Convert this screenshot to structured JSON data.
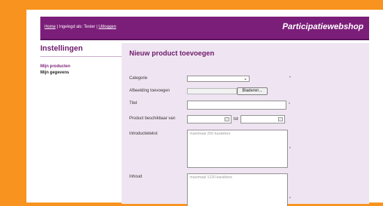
{
  "header": {
    "home_link": "Home",
    "separator1": " | Ingelogd als: Tester | ",
    "logout_link": "Uitloggen",
    "brand": "Participatiewebshop"
  },
  "sidebar": {
    "title": "Instellingen",
    "items": [
      {
        "label": "Mijn producten",
        "active": true
      },
      {
        "label": "Mijn gegevens",
        "active": false
      }
    ]
  },
  "form": {
    "title": "Nieuw product toevoegen",
    "category_label": "Categorie",
    "category_value": "",
    "image_label": "Afbeelding toevoegen",
    "browse_button": "Bladeren...",
    "title_label": "Titel",
    "title_value": "",
    "availability_label": "Product beschikbaar van",
    "date_separator": "tot",
    "date_from_value": "",
    "date_to_value": "",
    "intro_label": "Introductietekst",
    "intro_placeholder": "maximaal 250 karakters",
    "content_label": "Inhoud",
    "content_placeholder": "maximaal 1120 karakters",
    "required_marker": "*"
  },
  "colors": {
    "background": "#f7931e",
    "header": "#7b1e79",
    "accent": "#6c1a6a",
    "panel": "#efe4f1"
  }
}
